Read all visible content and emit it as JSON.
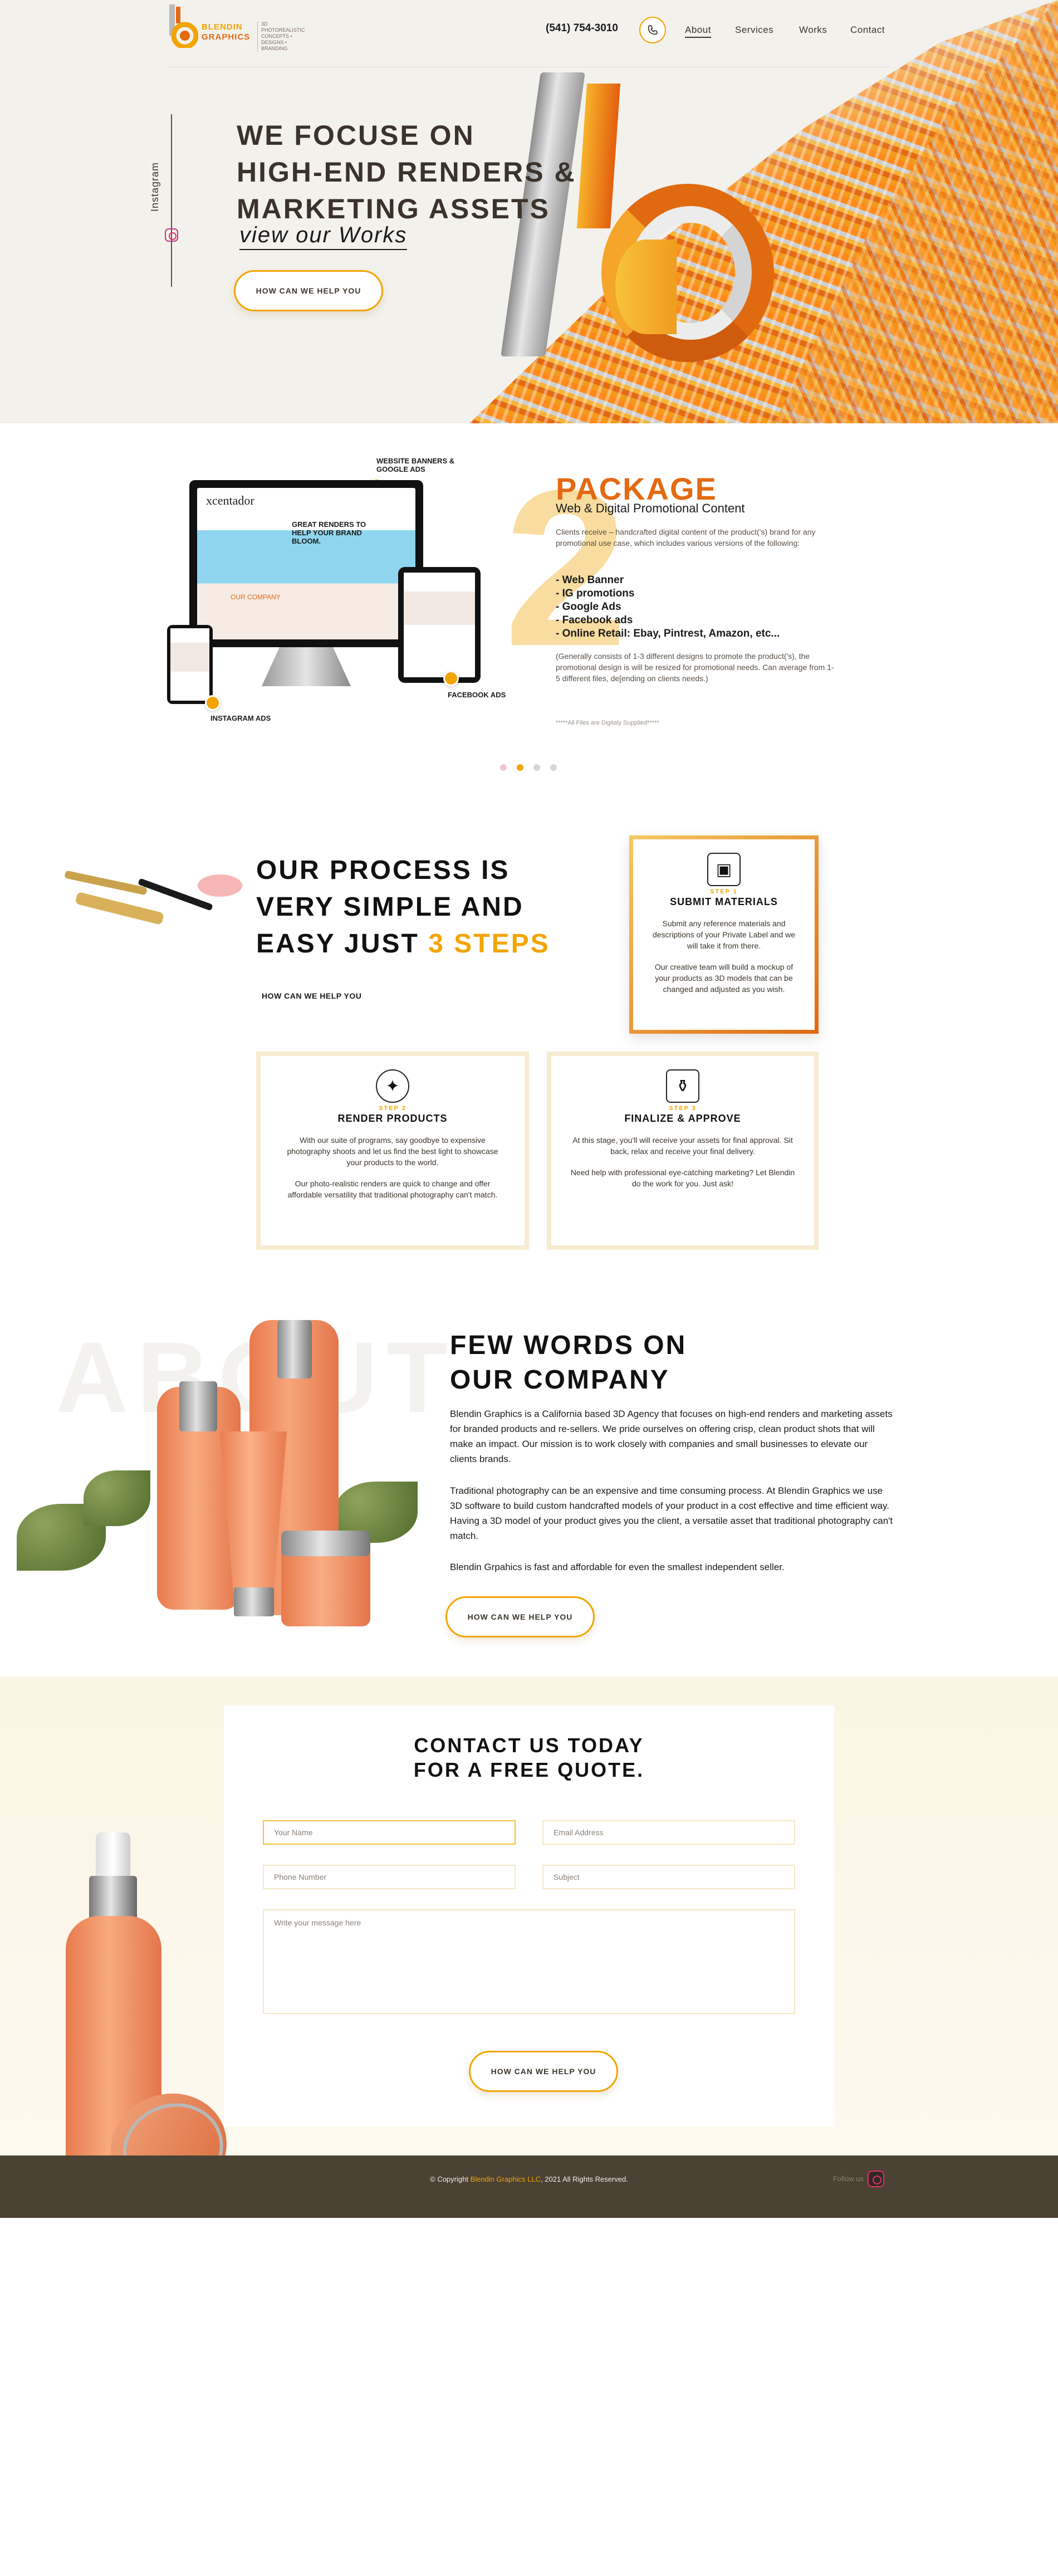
{
  "brand": {
    "name_line1": "BLENDIN",
    "name_line2": "GRAPHICS",
    "tagline": "3D PHOTOREALISTIC CONCEPTS • DESIGNS • BRANDING"
  },
  "header": {
    "phone": "(541) 754-3010",
    "nav": [
      {
        "label": "About"
      },
      {
        "label": "Services"
      },
      {
        "label": "Works"
      },
      {
        "label": "Contact"
      }
    ]
  },
  "hero": {
    "title_lines": [
      "WE FOCUSE ON",
      "HIGH-END RENDERS &",
      "MARKETING ASSETS"
    ],
    "subtitle": "view our Works",
    "cta": "HOW CAN WE HELP YOU",
    "social_label": "Instagram"
  },
  "package": {
    "number": "2",
    "title": "PACKAGE",
    "subtitle": "Web & Digital Promotional Content",
    "intro": "Clients receive – handcrafted digital content of the product('s) brand for any promotional use case, which includes various versions of the following:",
    "items": [
      "- Web Banner",
      "- IG promotions",
      "- Google Ads",
      "- Facebook ads",
      "- Online Retail: Ebay, Pintrest, Amazon, etc..."
    ],
    "details": "(Generally consists of 1-3 different designs to promote the product('s), the promotional design is will be resized for promotional needs. Can average from 1-5 different files, de[ending on clients needs.)",
    "note": "*****All Files are Digitaly Supplied*****",
    "labels": {
      "website": "WEBSITE BANNERS & GOOGLE ADS",
      "facebook": "FACEBOOK ADS",
      "instagram": "INSTAGRAM ADS"
    },
    "screen_brand": "xcentador",
    "screen_headline": "GREAT RENDERS TO HELP YOUR BRAND BLOOM.",
    "screen_section": "OUR COMPANY"
  },
  "process": {
    "title_lines": [
      "OUR PROCESS IS",
      "VERY SIMPLE AND"
    ],
    "title_last_plain": "EASY JUST ",
    "title_last_accent": "3 STEPS",
    "link": "HOW CAN WE HELP YOU",
    "steps": [
      {
        "step": "STEP 1",
        "title": "SUBMIT MATERIALS",
        "p1": "Submit any reference materials and descriptions of your Private Label and we will take it from there.",
        "p2": "Our creative team will build a mockup of your products as 3D models that can be changed and adjusted as you wish."
      },
      {
        "step": "STEP 2",
        "title": "RENDER PRODUCTS",
        "p1": "With our suite of programs, say goodbye to expensive photography shoots and let us find the best light to showcase your products to the world.",
        "p2": "Our photo-realistic renders are quick to change and offer affordable versatility that traditional photography can't match."
      },
      {
        "step": "STEP 3",
        "title": "FINALIZE & APPROVE",
        "p1": "At this stage, you'll will receive your assets for final approval. Sit back, relax and receive your final delivery.",
        "p2": "Need help with professional eye-catching marketing? Let Blendin do the work for you. Just ask!"
      }
    ]
  },
  "about": {
    "ghost": "ABOUT",
    "title_lines": [
      "FEW WORDS ON",
      "OUR COMPANY"
    ],
    "p1": "Blendin Graphics is a California based 3D Agency that focuses on high-end renders and marketing assets for branded products and re-sellers. We pride ourselves on offering crisp, clean product shots that will make an impact. Our mission is to work closely with companies and small businesses to elevate our clients brands.",
    "p2": "Traditional photography can be an expensive and time consuming process. At Blendin Graphics we use 3D software to build custom handcrafted models of your product in a cost effective and time efficient way. Having a 3D model of your product gives you the client, a versatile asset that traditional photography can't match.",
    "p3": "Blendin Grpahics is fast and affordable for even the smallest independent seller.",
    "cta": "HOW CAN WE HELP YOU"
  },
  "contact": {
    "title_line1": "CONTACT US TODAY",
    "title_line2": "FOR A FREE QUOTE.",
    "fields": {
      "name": "Your Name",
      "email": "Email Address",
      "phone": "Phone Number",
      "subject": "Subject",
      "message": "Write your message here"
    },
    "submit": "HOW CAN WE HELP YOU"
  },
  "footer": {
    "copyright_pre": "© Copyright ",
    "copyright_brand": "Blendin Graphics LLC",
    "copyright_post": ", 2021 All Rights Reserved.",
    "follow": "Follow us"
  },
  "colors": {
    "accent": "#f2a400",
    "orange": "#e36a12",
    "footer": "#4a4233"
  }
}
